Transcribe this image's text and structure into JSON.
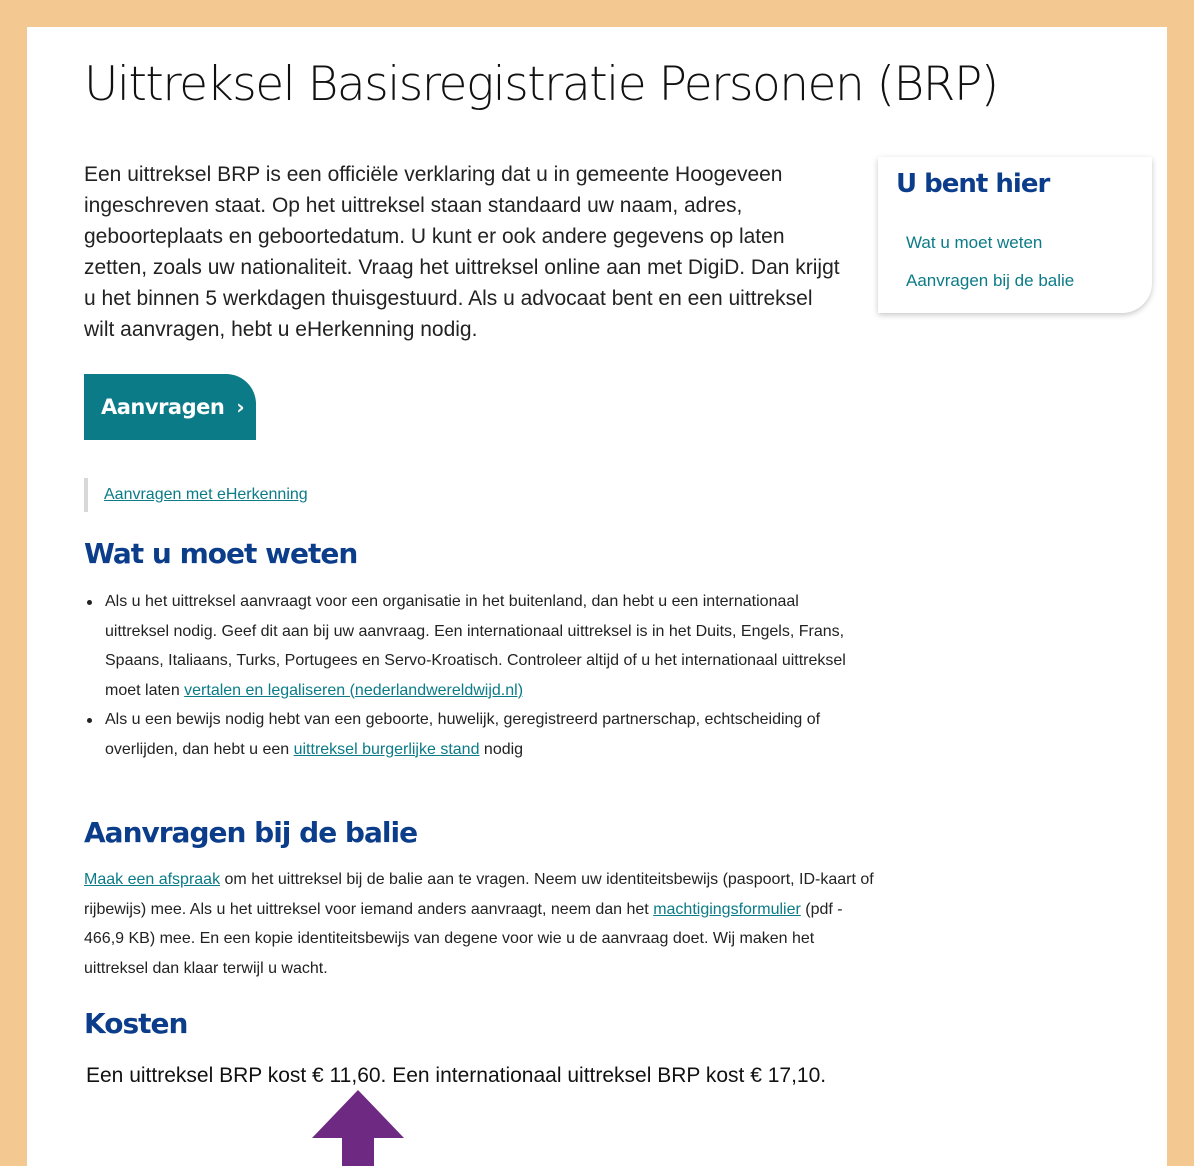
{
  "title": "Uittreksel Basisregistratie Personen (BRP)",
  "intro": "Een uittreksel BRP is een officiële verklaring dat u in gemeente Hoogeveen ingeschreven staat. Op het uittreksel staan standaard uw naam, adres, geboorteplaats en geboortedatum. U kunt er ook andere gegevens op laten zetten, zoals uw nationaliteit. Vraag het uittreksel online aan met DigiD. Dan krijgt u het binnen 5 werkdagen thuisgestuurd. Als u advocaat bent en een uittreksel wilt aanvragen, hebt u eHerkenning nodig.",
  "cta": {
    "label": "Aanvragen",
    "chevron": "›"
  },
  "alt_link": "Aanvragen met eHerkenning",
  "section_know": {
    "heading": "Wat u moet weten",
    "items": [
      {
        "text": "Als u het uittreksel aanvraagt voor een organisatie in het buitenland, dan hebt u een internationaal uittreksel nodig. Geef dit aan bij uw aanvraag. Een internationaal uittreksel is in het Duits, Engels, Frans, Spaans, Italiaans, Turks, Portugees en Servo-Kroatisch. Controleer altijd of u het internationaal uittreksel moet laten ",
        "link": "vertalen en legaliseren (nederlandwereldwijd.nl)",
        "after": ""
      },
      {
        "text": "Als u een bewijs nodig hebt van een geboorte, huwelijk, geregistreerd partnerschap, echtscheiding of overlijden, dan hebt u een ",
        "link": "uittreksel burgerlijke stand",
        "after": " nodig"
      }
    ]
  },
  "section_balie": {
    "heading": "Aanvragen bij de balie",
    "link1": "Maak een afspraak",
    "text1": " om het uittreksel bij de balie aan te vragen. Neem uw identiteitsbewijs (paspoort, ID-kaart of rijbewijs) mee. Als u het uittreksel voor iemand anders aanvraagt, neem dan het ",
    "link2": "machtigingsformulier",
    "text2": " (pdf - 466,9 KB) mee. En een kopie identiteitsbewijs van degene voor wie u de aanvraag doet. Wij maken het uittreksel dan klaar terwijl u wacht."
  },
  "section_kosten": {
    "heading": "Kosten",
    "text": "Een uittreksel BRP kost € 11,60. Een internationaal uittreksel BRP kost € 17,10."
  },
  "aside": {
    "heading": "U bent hier",
    "items": [
      "Wat u moet weten",
      "Aanvragen bij de balie"
    ]
  },
  "colors": {
    "outer_frame": "#f4c891",
    "heading_blue": "#0c3d8a",
    "teal": "#0b7b87",
    "arrow_purple": "#6e2a83"
  }
}
